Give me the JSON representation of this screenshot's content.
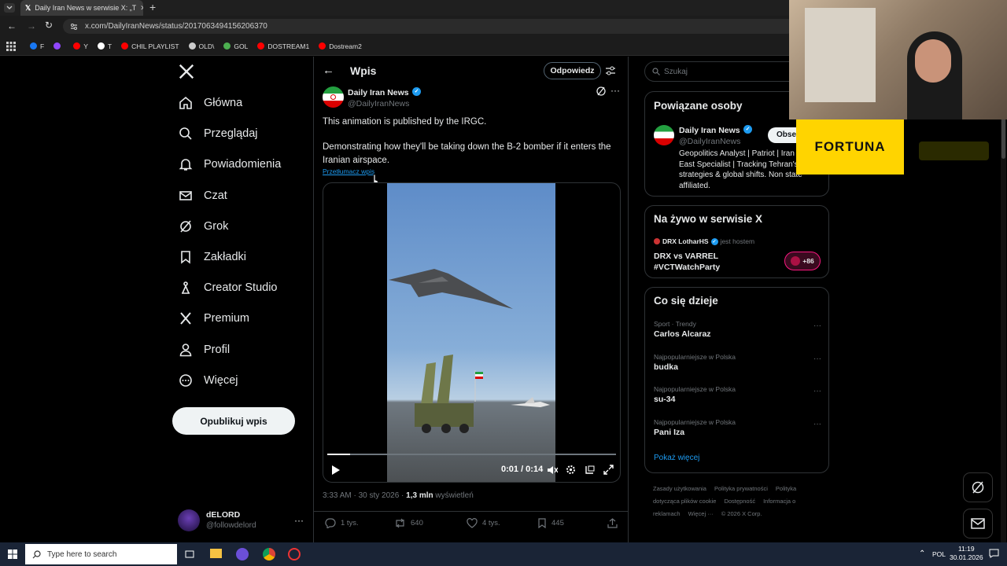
{
  "browser": {
    "tab_title": "Daily Iran News w serwisie X: „T",
    "url": "x.com/DailyIranNews/status/2017063494156206370",
    "bookmarks": [
      {
        "label": "F",
        "color": "#1877f2"
      },
      {
        "label": "",
        "color": "#9147ff"
      },
      {
        "label": "Y",
        "color": "#ff0000"
      },
      {
        "label": "T",
        "color": "#ffffff"
      },
      {
        "label": "CHIL PLAYLIST",
        "color": "#ff0000"
      },
      {
        "label": "OLD\\",
        "color": "#cccccc"
      },
      {
        "label": "GOL",
        "color": "#4caf50"
      },
      {
        "label": "DOSTREAM1",
        "color": "#ff0000"
      },
      {
        "label": "Dostream2",
        "color": "#ff0000"
      }
    ]
  },
  "nav": {
    "items": [
      {
        "label": "Główna",
        "icon": "home-icon"
      },
      {
        "label": "Przeglądaj",
        "icon": "search-icon"
      },
      {
        "label": "Powiadomienia",
        "icon": "bell-icon"
      },
      {
        "label": "Czat",
        "icon": "mail-icon"
      },
      {
        "label": "Grok",
        "icon": "grok-icon"
      },
      {
        "label": "Zakładki",
        "icon": "bookmark-icon"
      },
      {
        "label": "Creator Studio",
        "icon": "creator-icon"
      },
      {
        "label": "Premium",
        "icon": "x-icon"
      },
      {
        "label": "Profil",
        "icon": "person-icon"
      },
      {
        "label": "Więcej",
        "icon": "more-circle-icon"
      }
    ],
    "publish_label": "Opublikuj wpis",
    "account_name": "dELORD",
    "account_handle": "@followdelord"
  },
  "post": {
    "header_title": "Wpis",
    "reply_button": "Odpowiedz",
    "author_name": "Daily Iran News",
    "author_handle": "@DailyIranNews",
    "text_line1": "This animation is published by the IRGC.",
    "text_line2": "Demonstrating how they'll be taking down the B-2 bomber if it enters the Iranian airspace.",
    "translate_link": "Przetłumacz wpis",
    "video_time": "0:01 / 0:14",
    "video_progress": 0.08,
    "timestamp": "3:33 AM · 30 sty 2026 · ",
    "views_count": "1,3 mln",
    "views_label": " wyświetleń",
    "replies": "1 tys.",
    "reposts": "640",
    "likes": "4 tys.",
    "bookmarks": "445"
  },
  "sidebar": {
    "search_placeholder": "Szukaj",
    "related_title": "Powiązane osoby",
    "related_name": "Daily Iran News",
    "related_handle": "@DailyIranNews",
    "follow_label": "Obse",
    "related_bio": "Geopolitics Analyst | Patriot | Iran Middle East Specialist | Tracking Tehran's strategies & global shifts. Non state affiliated.",
    "live_title": "Na żywo w serwisie X",
    "live_host": "DRX LotharHS",
    "live_host_suffix": "jest hostem",
    "live_title_line1": "DRX vs VARREL",
    "live_title_line2": "#VCTWatchParty",
    "live_count": "+86",
    "trending_title": "Co się dzieje",
    "trends": [
      {
        "context": "Sport · Trendy",
        "name": "Carlos Alcaraz"
      },
      {
        "context": "Najpopularniejsze w Polska",
        "name": "budka"
      },
      {
        "context": "Najpopularniejsze w Polska",
        "name": "su-34"
      },
      {
        "context": "Najpopularniejsze w Polska",
        "name": "Pani Iza"
      }
    ],
    "show_more": "Pokaż więcej",
    "footer_links": [
      "Zasady użytkowania",
      "Polityka prywatności",
      "Polityka dotycząca plików cookie",
      "Dostępność",
      "Informacja o reklamach",
      "Więcej ···",
      "© 2026 X Corp."
    ]
  },
  "overlay": {
    "sponsor": "FORTUNA",
    "sponsor_color": "#ffd400"
  },
  "taskbar": {
    "search_placeholder": "Type here to search",
    "lang": "POL",
    "time": "11:19",
    "date": "30.01.2026"
  }
}
